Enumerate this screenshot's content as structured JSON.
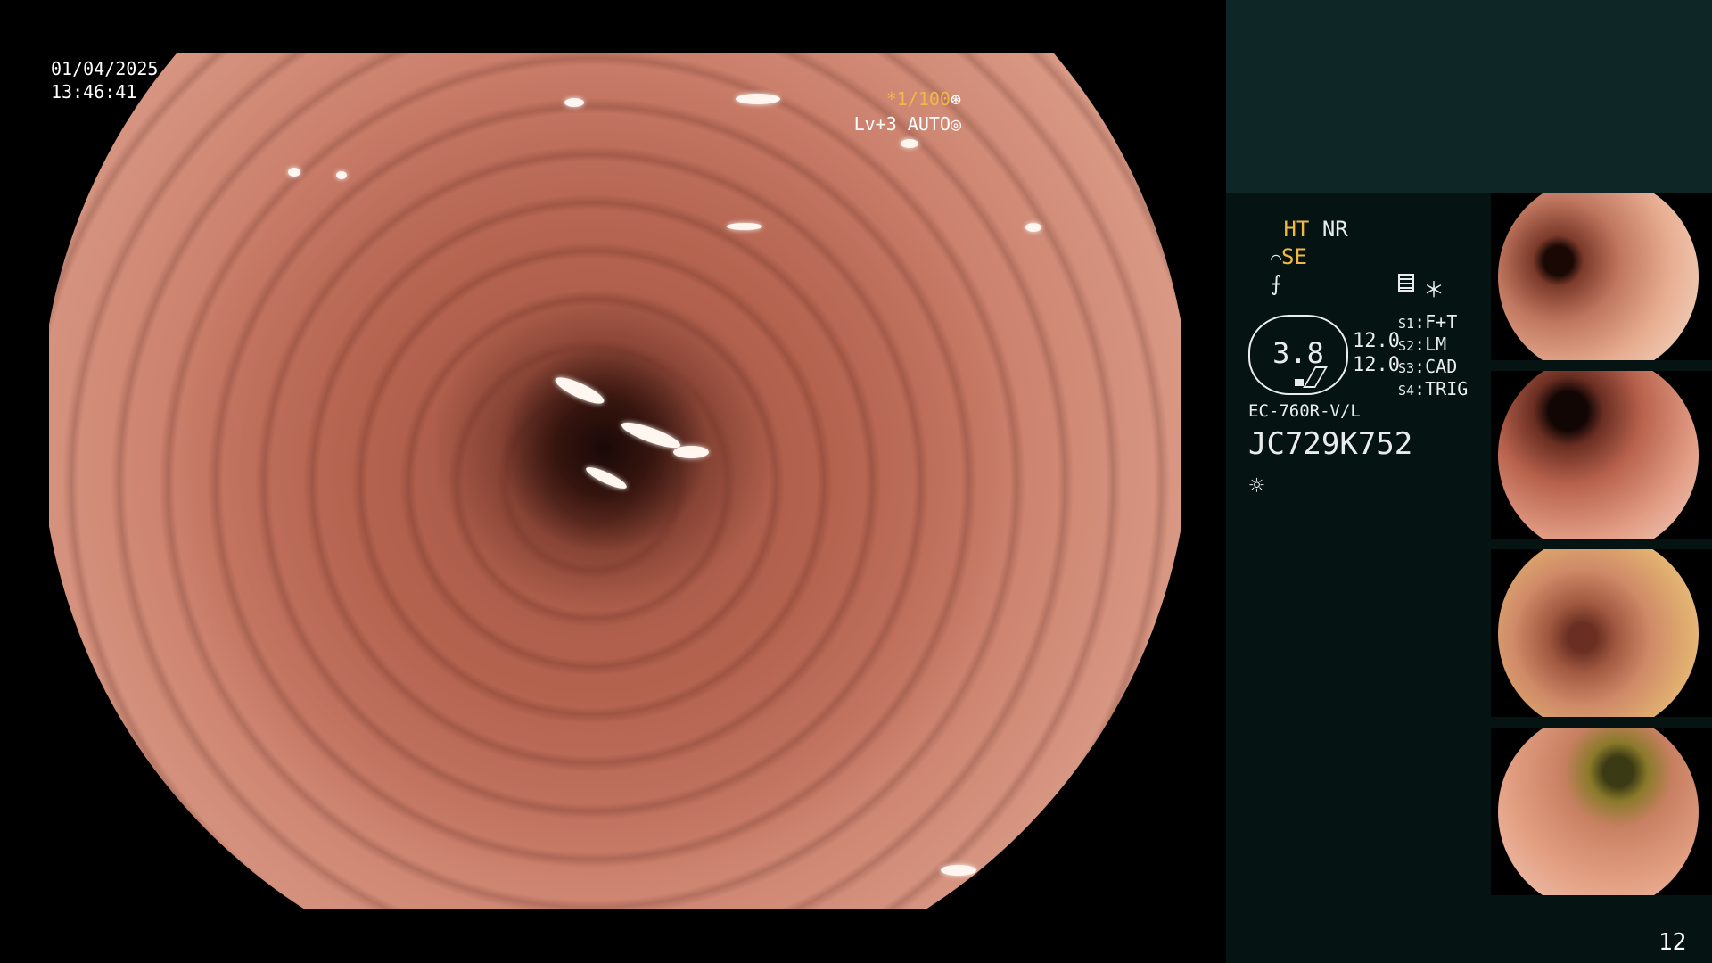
{
  "overlay": {
    "date": "01/04/2025",
    "time": "13:46:41",
    "zoom": "*1/100",
    "level": "Lv+3 AUTO"
  },
  "panel": {
    "mode_ht": "HT",
    "mode_nr": "NR",
    "mode_se": "SE",
    "gauge_value": "3.8",
    "value_a": "12.0",
    "value_b": "12.0",
    "presets": [
      {
        "key": "S1",
        "value": "F+T"
      },
      {
        "key": "S2",
        "value": "LM"
      },
      {
        "key": "S3",
        "value": "CAD"
      },
      {
        "key": "S4",
        "value": "TRIG"
      }
    ],
    "scope_model": "EC-760R-V/L",
    "scope_serial": "JC729K752",
    "page_number": "12"
  },
  "icons": {
    "shutter": "aperture-icon",
    "auto": "target-icon",
    "scope": "scope-icon",
    "enhance": "enhance-icon",
    "grid": "grid-icon",
    "asterisk": "asterisk-icon",
    "light": "light-icon"
  },
  "colors": {
    "accent": "#f0b845",
    "panel_bg": "#051312",
    "panel_header": "#0e2726"
  }
}
